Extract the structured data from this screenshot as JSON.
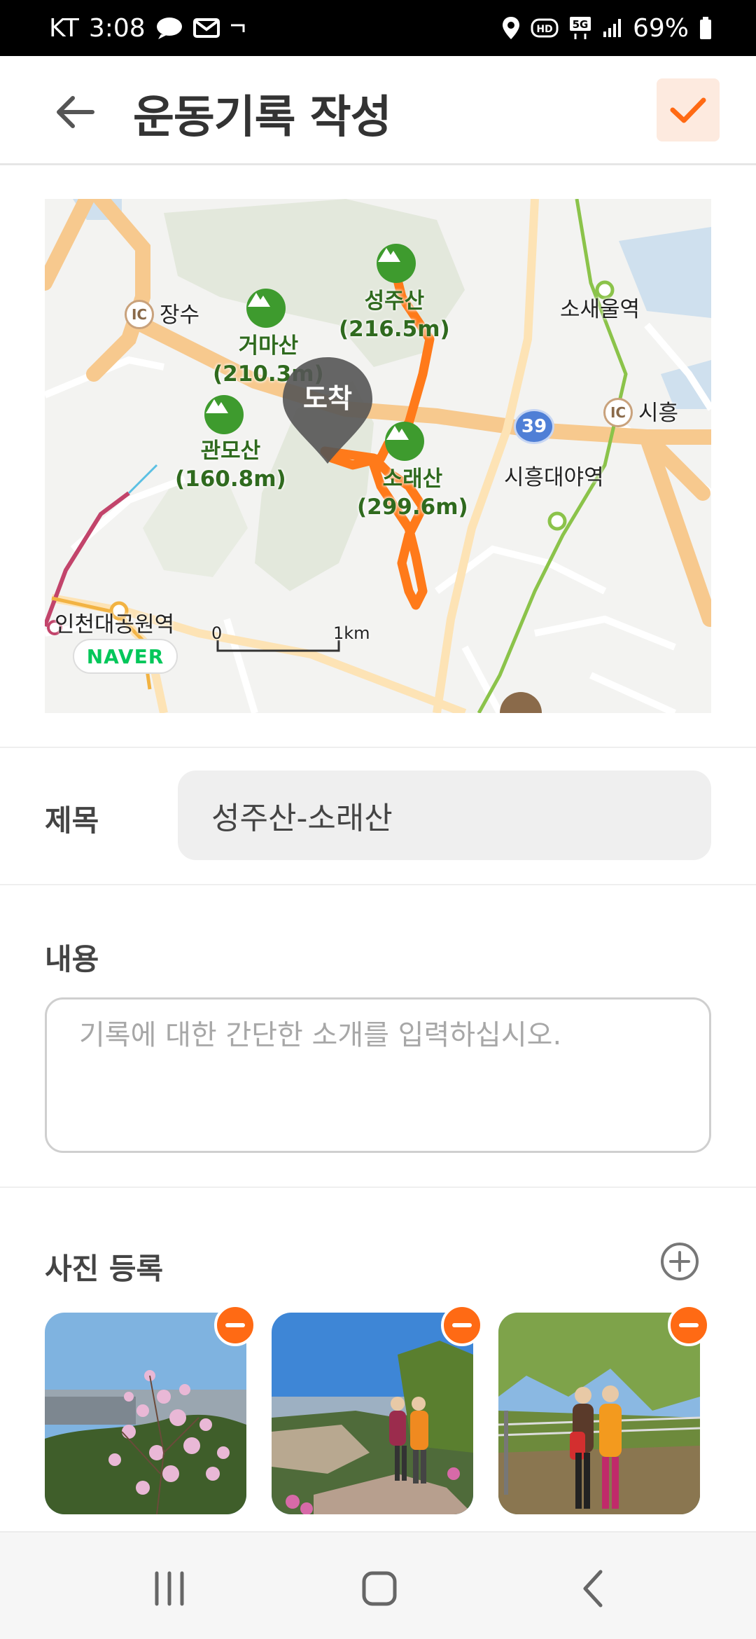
{
  "status_bar": {
    "carrier": "KT",
    "time": "3:08",
    "network": "5G",
    "battery": "69%"
  },
  "header": {
    "title": "운동기록 작성"
  },
  "map": {
    "mountains": [
      {
        "name": "성주산",
        "height": "(216.5m)"
      },
      {
        "name": "거마산",
        "height": "(210.3m)"
      },
      {
        "name": "관모산",
        "height": "(160.8m)"
      },
      {
        "name": "소래산",
        "height": "(299.6m)"
      }
    ],
    "places": {
      "jangsu": "장수",
      "siheung_ic": "시흥",
      "sosaeul": "소새울역",
      "siheungdaeya": "시흥대야역",
      "incheon_park": "인천대공원역"
    },
    "ic_badge": "IC",
    "route_number": "39",
    "arrival_label": "도착",
    "scale_start": "0",
    "scale_end": "1km",
    "provider": "NAVER",
    "colors": {
      "route": "#ff7a1a",
      "road": "#f7c98e",
      "park": "#e3e8dc"
    }
  },
  "form": {
    "title_label": "제목",
    "title_value": "성주산-소래산",
    "content_label": "내용",
    "content_placeholder": "기록에 대한 간단한 소개를 입력하십시오.",
    "photo_label": "사진 등록"
  },
  "icons": {
    "back": "arrow-left-icon",
    "confirm": "check-icon",
    "add_photo": "plus-circle-icon",
    "remove_photo": "minus-circle-icon"
  },
  "accent_color": "#ff6a14"
}
